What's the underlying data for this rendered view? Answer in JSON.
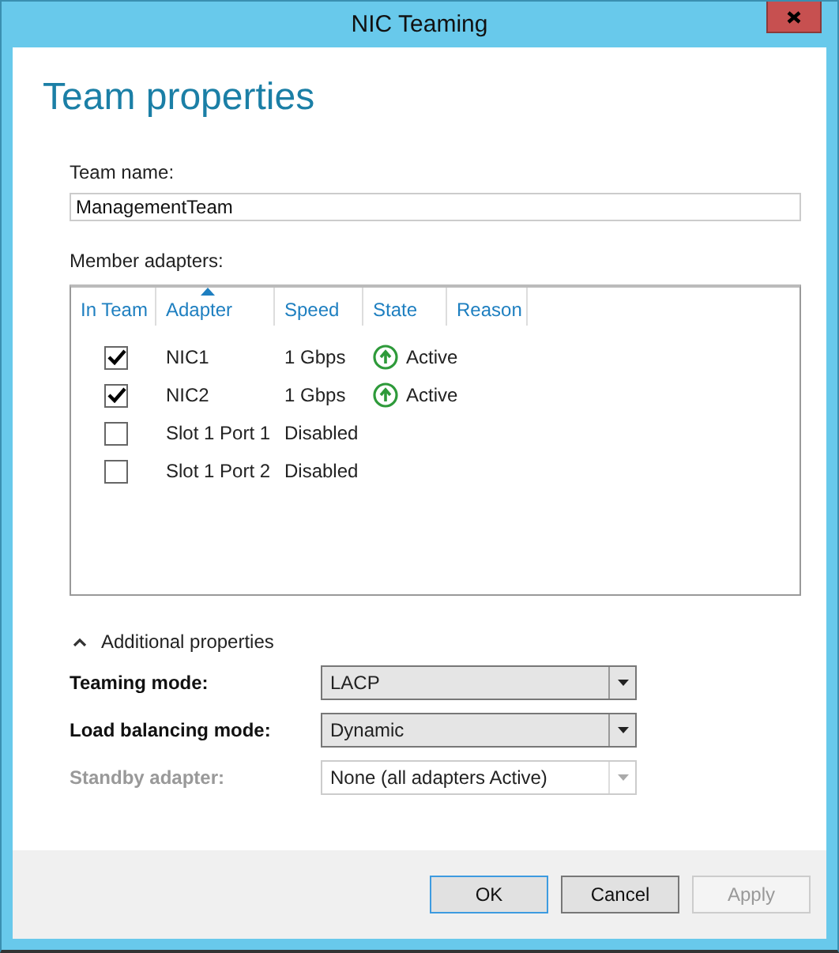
{
  "window": {
    "title": "NIC Teaming"
  },
  "heading": "Team properties",
  "team_name": {
    "label": "Team name:",
    "value": "ManagementTeam"
  },
  "member_adapters": {
    "label": "Member adapters:",
    "columns": [
      {
        "label": "In Team",
        "sorted": false
      },
      {
        "label": "Adapter",
        "sorted": true
      },
      {
        "label": "Speed",
        "sorted": false
      },
      {
        "label": "State",
        "sorted": false
      },
      {
        "label": "Reason",
        "sorted": false
      }
    ],
    "rows": [
      {
        "checked": true,
        "adapter": "NIC1",
        "speed": "1 Gbps",
        "state": {
          "kind": "active",
          "text": "Active"
        }
      },
      {
        "checked": true,
        "adapter": "NIC2",
        "speed": "1 Gbps",
        "state": {
          "kind": "active",
          "text": "Active"
        }
      },
      {
        "checked": false,
        "adapter": "Slot 1 Port 1",
        "speed": "Disabled"
      },
      {
        "checked": false,
        "adapter": "Slot 1 Port 2",
        "speed": "Disabled"
      }
    ]
  },
  "additional_properties": {
    "label": "Additional properties",
    "expanded": true,
    "fields": [
      {
        "label": "Teaming mode:",
        "value": "LACP",
        "disabled": false
      },
      {
        "label": "Load balancing mode:",
        "value": "Dynamic",
        "disabled": false
      },
      {
        "label": "Standby adapter:",
        "value": "None (all adapters Active)",
        "disabled": true
      }
    ]
  },
  "buttons": [
    {
      "label": "OK",
      "kind": "default"
    },
    {
      "label": "Cancel",
      "kind": "normal"
    },
    {
      "label": "Apply",
      "kind": "disabled"
    }
  ]
}
